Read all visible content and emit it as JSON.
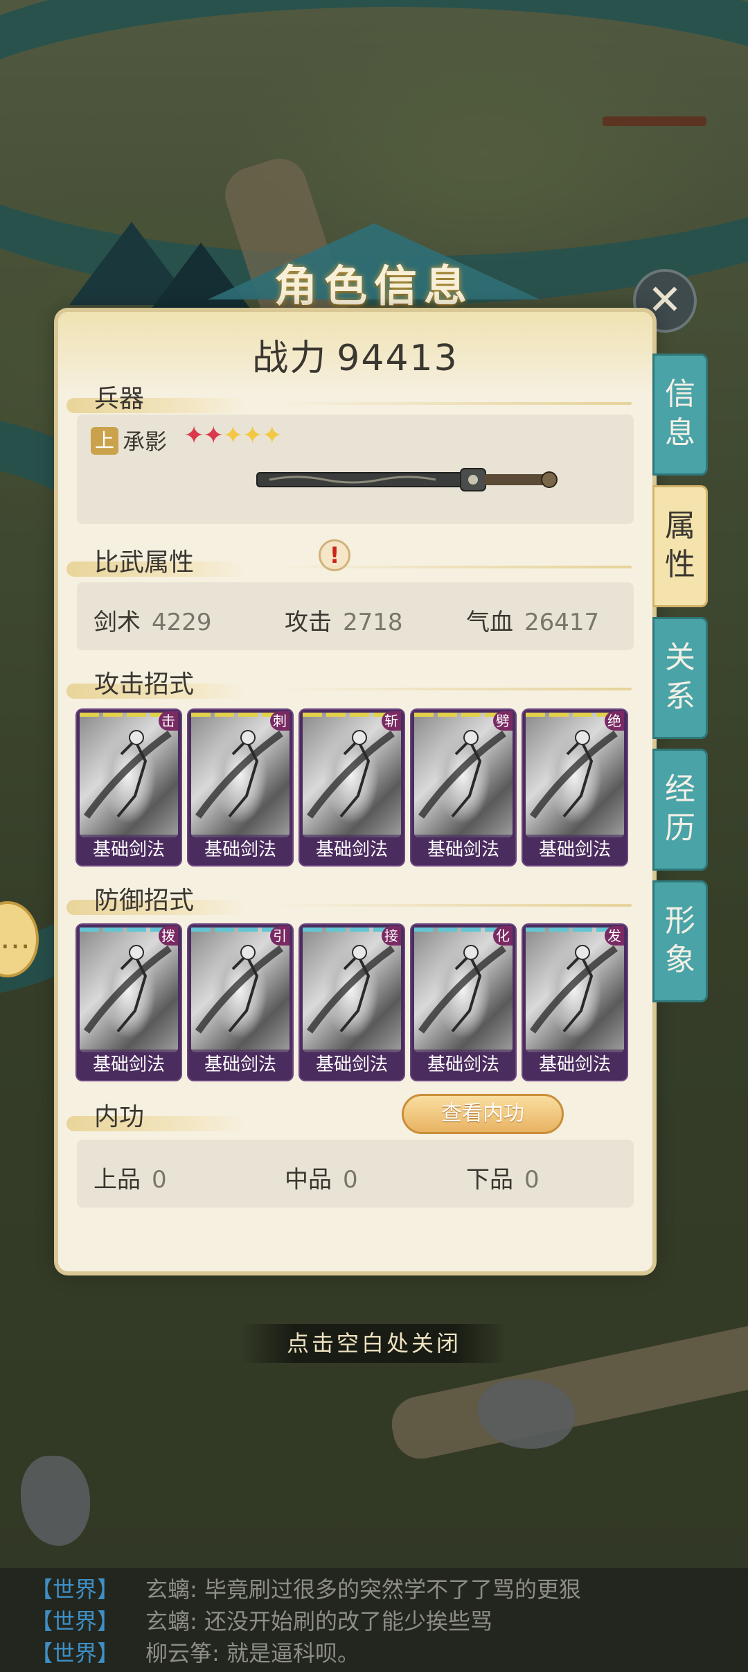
{
  "title": "角色信息",
  "close_icon": "close-icon",
  "power": {
    "label": "战力",
    "value": "94413"
  },
  "weapon": {
    "section_label": "兵器",
    "grade": "上",
    "name": "承影",
    "stars": {
      "filled_red": 2,
      "filled_gold": 3,
      "total": 5
    }
  },
  "combat_attrs": {
    "section_label": "比武属性",
    "alert_icon": "!",
    "items": [
      {
        "label": "剑术",
        "value": "4229"
      },
      {
        "label": "攻击",
        "value": "2718"
      },
      {
        "label": "气血",
        "value": "26417"
      }
    ]
  },
  "attack_moves": {
    "section_label": "攻击招式",
    "cards": [
      {
        "tag": "击",
        "name": "基础剑法"
      },
      {
        "tag": "刺",
        "name": "基础剑法"
      },
      {
        "tag": "斩",
        "name": "基础剑法"
      },
      {
        "tag": "劈",
        "name": "基础剑法"
      },
      {
        "tag": "绝",
        "name": "基础剑法"
      }
    ],
    "bar_color": "#e2d14a"
  },
  "defense_moves": {
    "section_label": "防御招式",
    "cards": [
      {
        "tag": "拨",
        "name": "基础剑法"
      },
      {
        "tag": "引",
        "name": "基础剑法"
      },
      {
        "tag": "接",
        "name": "基础剑法"
      },
      {
        "tag": "化",
        "name": "基础剑法"
      },
      {
        "tag": "发",
        "name": "基础剑法"
      }
    ],
    "bar_color": "#63c6d4"
  },
  "inner_power": {
    "section_label": "内功",
    "button_label": "查看内功",
    "items": [
      {
        "label": "上品",
        "value": "0"
      },
      {
        "label": "中品",
        "value": "0"
      },
      {
        "label": "下品",
        "value": "0"
      }
    ]
  },
  "tabs": [
    {
      "label1": "信",
      "label2": "息",
      "active": false
    },
    {
      "label1": "属",
      "label2": "性",
      "active": true
    },
    {
      "label1": "关",
      "label2": "系",
      "active": false
    },
    {
      "label1": "经",
      "label2": "历",
      "active": false
    },
    {
      "label1": "形",
      "label2": "象",
      "active": false
    }
  ],
  "close_hint": "点击空白处关闭",
  "chat": [
    {
      "channel": "【世界】",
      "user": "玄螭",
      "text": "毕竟刷过很多的突然学不了了骂的更狠"
    },
    {
      "channel": "【世界】",
      "user": "玄螭",
      "text": "还没开始刷的改了能少挨些骂"
    },
    {
      "channel": "【世界】",
      "user": "柳云筝",
      "text": "就是逼科呗。"
    }
  ],
  "colors": {
    "tab_teal": "#4aa3a6",
    "tab_active": "#f4e3ad",
    "card_purple": "#4b2c5e",
    "accent_gold": "#e8b363"
  }
}
